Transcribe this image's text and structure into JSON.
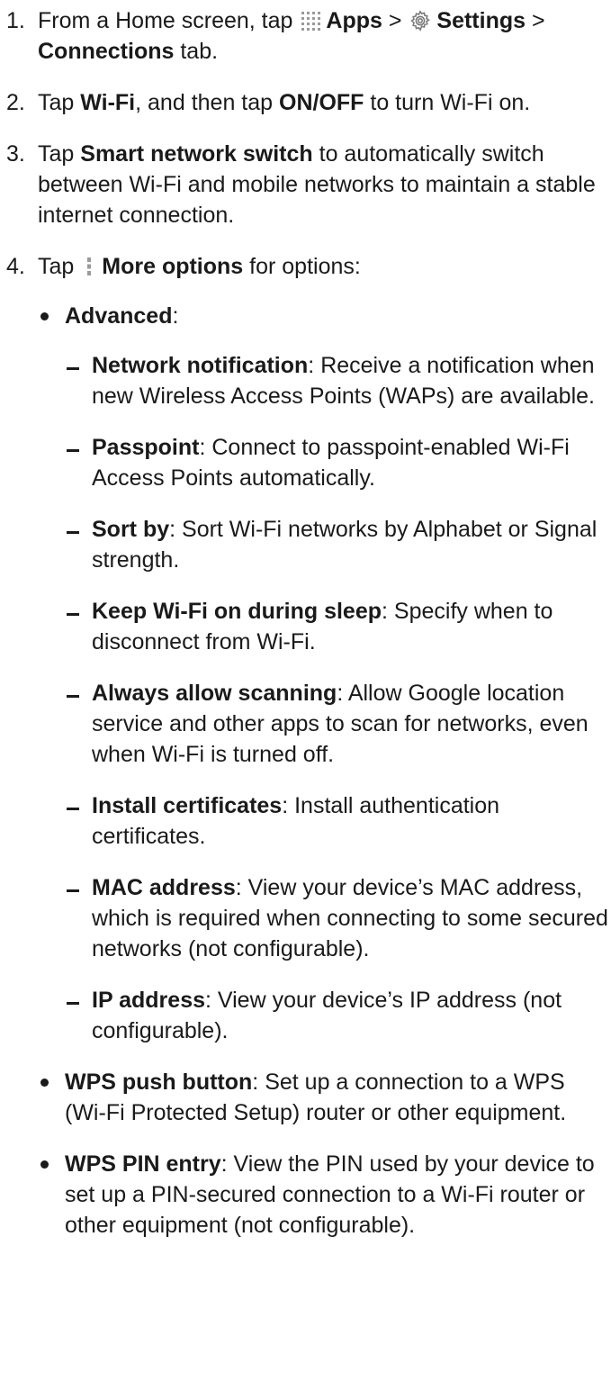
{
  "steps": [
    {
      "num": "1.",
      "parts": {
        "t1": "From a Home screen, tap ",
        "icon1": "apps-grid-icon",
        "b1": "Apps",
        "t2": " > ",
        "icon2": "settings-gear-icon",
        "b2": "Settings",
        "t3": " > ",
        "b3": "Connections",
        "t4": " tab."
      }
    },
    {
      "num": "2.",
      "parts": {
        "t1": "Tap ",
        "b1": "Wi-Fi",
        "t2": ", and then tap ",
        "b2": "ON/OFF",
        "t3": " to turn Wi-Fi on."
      }
    },
    {
      "num": "3.",
      "parts": {
        "t1": "Tap ",
        "b1": "Smart network switch",
        "t2": " to automatically switch between Wi-Fi and mobile networks to maintain a stable internet connection."
      }
    },
    {
      "num": "4.",
      "parts": {
        "t1": "Tap ",
        "icon1": "more-options-icon",
        "b1": "More options",
        "t2": " for options:"
      }
    }
  ],
  "bullets": [
    {
      "term": "Advanced",
      "desc": ":"
    },
    {
      "term": "WPS push button",
      "desc": ": Set up a connection to a WPS (Wi-Fi Protected Setup) router or other equipment."
    },
    {
      "term": "WPS PIN entry",
      "desc": ": View the PIN used by your device to set up a PIN-secured connection to a Wi-Fi router or other equipment (not configurable)."
    }
  ],
  "advanced_items": [
    {
      "term": "Network notification",
      "desc": ": Receive a notification when new Wireless Access Points (WAPs) are available."
    },
    {
      "term": "Passpoint",
      "desc": ": Connect to passpoint-enabled Wi-Fi Access Points automatically."
    },
    {
      "term": "Sort by",
      "desc": ": Sort Wi-Fi networks by Alphabet or Signal strength."
    },
    {
      "term": "Keep Wi-Fi on during sleep",
      "desc": ": Specify when to disconnect from Wi-Fi."
    },
    {
      "term": "Always allow scanning",
      "desc": ": Allow Google location service and other apps to scan for networks, even when Wi-Fi is turned off."
    },
    {
      "term": "Install certificates",
      "desc": ": Install authentication certificates."
    },
    {
      "term": "MAC address",
      "desc": ": View your device’s MAC address, which is required when connecting to some secured networks (not configurable)."
    },
    {
      "term": "IP address",
      "desc": ": View your device’s IP address (not configurable)."
    }
  ]
}
